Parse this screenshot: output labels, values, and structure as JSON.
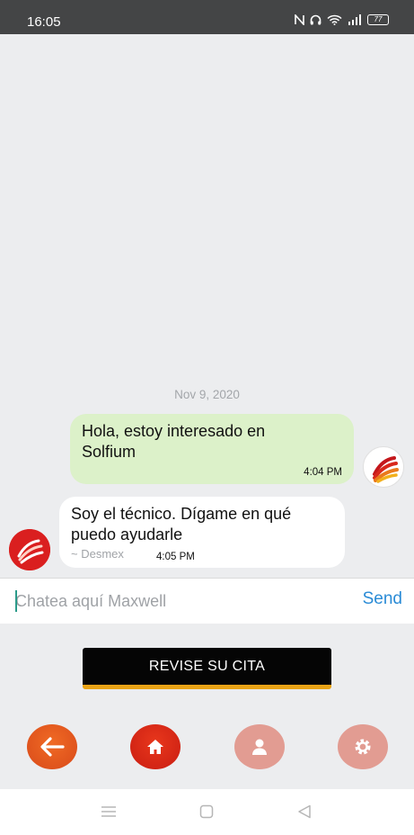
{
  "status_bar": {
    "time": "16:05",
    "battery": "77"
  },
  "chat": {
    "date": "Nov 9, 2020",
    "messages": [
      {
        "direction": "outgoing",
        "text_line1": "Hola, estoy interesado en",
        "text_line2": "Solfium",
        "time": "4:04 PM"
      },
      {
        "direction": "incoming",
        "text_line1": "Soy el técnico. Dígame en qué",
        "text_line2": "puedo ayudarle",
        "sender": "~ Desmex",
        "time": "4:05 PM"
      }
    ]
  },
  "composer": {
    "placeholder": "Chatea aquí Maxwell",
    "send_label": "Send"
  },
  "cita_button_label": "REVISE SU CITA",
  "nav": [
    {
      "name": "back",
      "icon": "arrow-left-icon"
    },
    {
      "name": "home",
      "icon": "home-icon"
    },
    {
      "name": "profile",
      "icon": "person-icon"
    },
    {
      "name": "settings",
      "icon": "gear-icon"
    }
  ],
  "colors": {
    "outgoing_bubble": "#dcf1c9",
    "incoming_bubble": "#ffffff",
    "send": "#2a8bd6",
    "cita_accent": "#e9a316",
    "nav_active": "#d84a1a",
    "nav_inactive": "#e29c92"
  }
}
